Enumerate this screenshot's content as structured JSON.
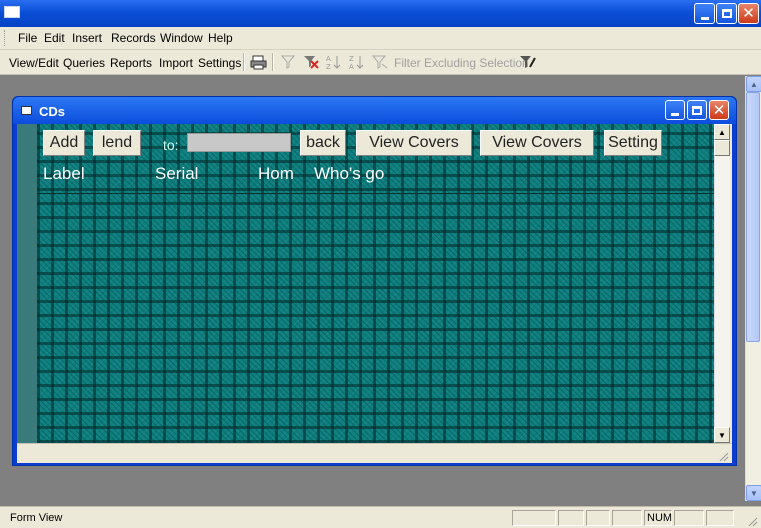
{
  "menubar": {
    "items": [
      "File",
      "Edit",
      "Insert",
      "Records",
      "Window",
      "Help"
    ]
  },
  "toolbar": {
    "view_edit": "View/Edit",
    "queries": "Queries",
    "reports": "Reports",
    "import": "Import",
    "settings": "Settings",
    "filter_excluding": "Filter Excluding Selection"
  },
  "cds_window": {
    "title": "CDs"
  },
  "form": {
    "buttons": {
      "add": "Add",
      "lend": "lend",
      "back": "back",
      "view_covers_1": "View Covers",
      "view_covers_2": "View Covers",
      "setting": "Setting"
    },
    "lend_to_label": "to:",
    "lend_to_value": "",
    "columns": {
      "label": "Label",
      "serial": "Serial",
      "home": "Hom",
      "whos_got": "Who's go"
    },
    "background_color": "#0f7f7f"
  },
  "statusbar": {
    "text": "Form View",
    "num": "NUM"
  }
}
